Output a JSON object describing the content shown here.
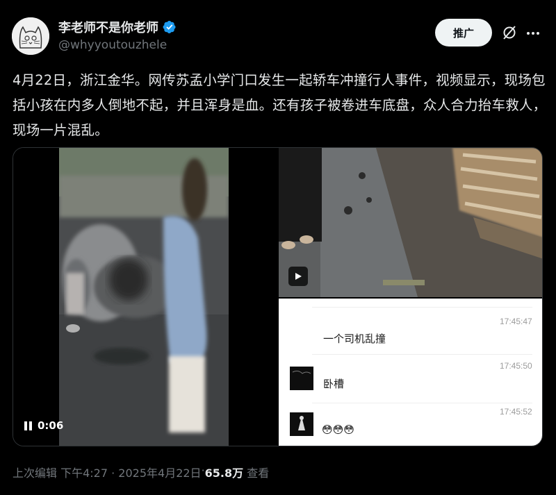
{
  "author": {
    "display_name": "李老师不是你老师",
    "handle": "@whyyoutouzhele",
    "verified": true
  },
  "actions": {
    "promote_label": "推广",
    "grok_icon": "grok-icon",
    "more_icon": "more-icon"
  },
  "post": {
    "text": "4月22日，浙江金华。网传苏孟小学门口发生一起轿车冲撞行人事件，视频显示，现场包括小孩在内多人倒地不起，并且浑身是血。还有孩子被卷进车底盘，众人合力抬车救人，现场一片混乱。"
  },
  "media": {
    "video": {
      "time": "0:06",
      "state": "paused"
    },
    "chat": {
      "messages": [
        {
          "time": "17:45:47",
          "text": "一个司机乱撞"
        },
        {
          "time": "17:45:50",
          "text": "卧槽"
        },
        {
          "time": "17:45:52",
          "text": "😳😳😳"
        }
      ]
    }
  },
  "meta": {
    "edited_label": "上次编辑",
    "timestamp": "下午4:27 · 2025年4月22日",
    "separator": " · ",
    "views_count": "65.8万",
    "views_label": "查看"
  },
  "colors": {
    "background": "#000000",
    "text_primary": "#e7e9ea",
    "text_secondary": "#71767b",
    "verified_blue": "#1d9bf0"
  }
}
